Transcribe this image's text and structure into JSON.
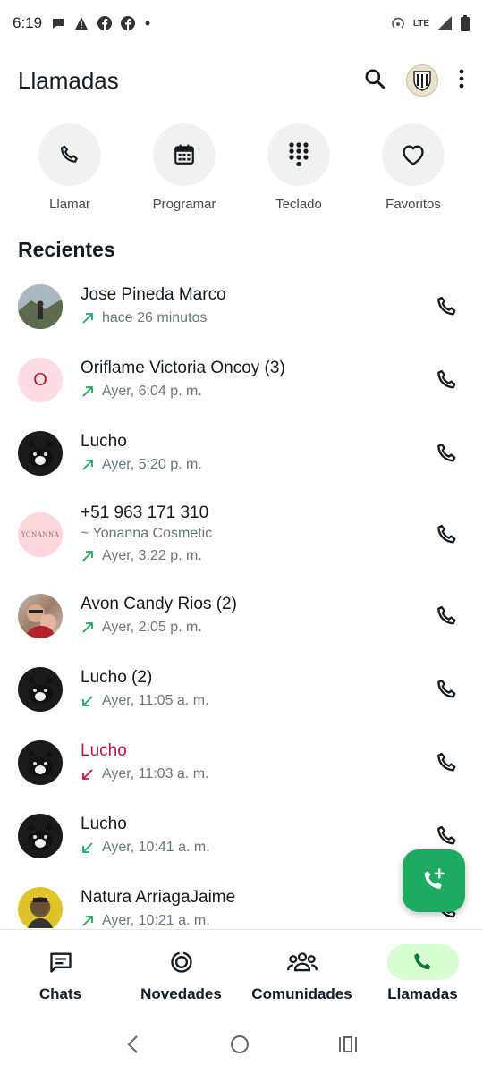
{
  "status": {
    "time": "6:19",
    "network": "LTE"
  },
  "header": {
    "title": "Llamadas"
  },
  "quick_actions": [
    {
      "label": "Llamar",
      "icon": "phone-icon"
    },
    {
      "label": "Programar",
      "icon": "calendar-icon"
    },
    {
      "label": "Teclado",
      "icon": "dialpad-icon"
    },
    {
      "label": "Favoritos",
      "icon": "heart-icon"
    }
  ],
  "section": {
    "title": "Recientes"
  },
  "calls": [
    {
      "name": "Jose Pineda Marco",
      "direction": "outgoing",
      "time": "hace 26 minutos"
    },
    {
      "name": "Oriflame Victoria Oncoy (3)",
      "direction": "outgoing",
      "time": "Ayer, 6:04 p. m.",
      "avatar_letter": "O"
    },
    {
      "name": "Lucho",
      "direction": "outgoing",
      "time": "Ayer, 5:20 p. m."
    },
    {
      "name": "+51 963 171 310",
      "subtitle": "~ Yonanna Cosmetic",
      "direction": "outgoing",
      "time": "Ayer, 3:22 p. m.",
      "avatar_text": "YONANNA"
    },
    {
      "name": "Avon Candy Rios (2)",
      "direction": "outgoing",
      "time": "Ayer, 2:05 p. m."
    },
    {
      "name": "Lucho (2)",
      "direction": "incoming",
      "time": "Ayer, 11:05 a. m."
    },
    {
      "name": "Lucho",
      "direction": "missed",
      "time": "Ayer, 11:03 a. m."
    },
    {
      "name": "Lucho",
      "direction": "incoming",
      "time": "Ayer, 10:41 a. m."
    },
    {
      "name": "Natura ArriagaJaime",
      "direction": "outgoing",
      "time": "Ayer, 10:21 a. m."
    }
  ],
  "bottom_nav": [
    {
      "label": "Chats",
      "icon": "chats-icon"
    },
    {
      "label": "Novedades",
      "icon": "updates-icon"
    },
    {
      "label": "Comunidades",
      "icon": "communities-icon"
    },
    {
      "label": "Llamadas",
      "icon": "calls-icon",
      "active": true
    }
  ],
  "colors": {
    "accent": "#1daa61",
    "missed": "#c0144a",
    "active_pill": "#d8fdd2"
  }
}
